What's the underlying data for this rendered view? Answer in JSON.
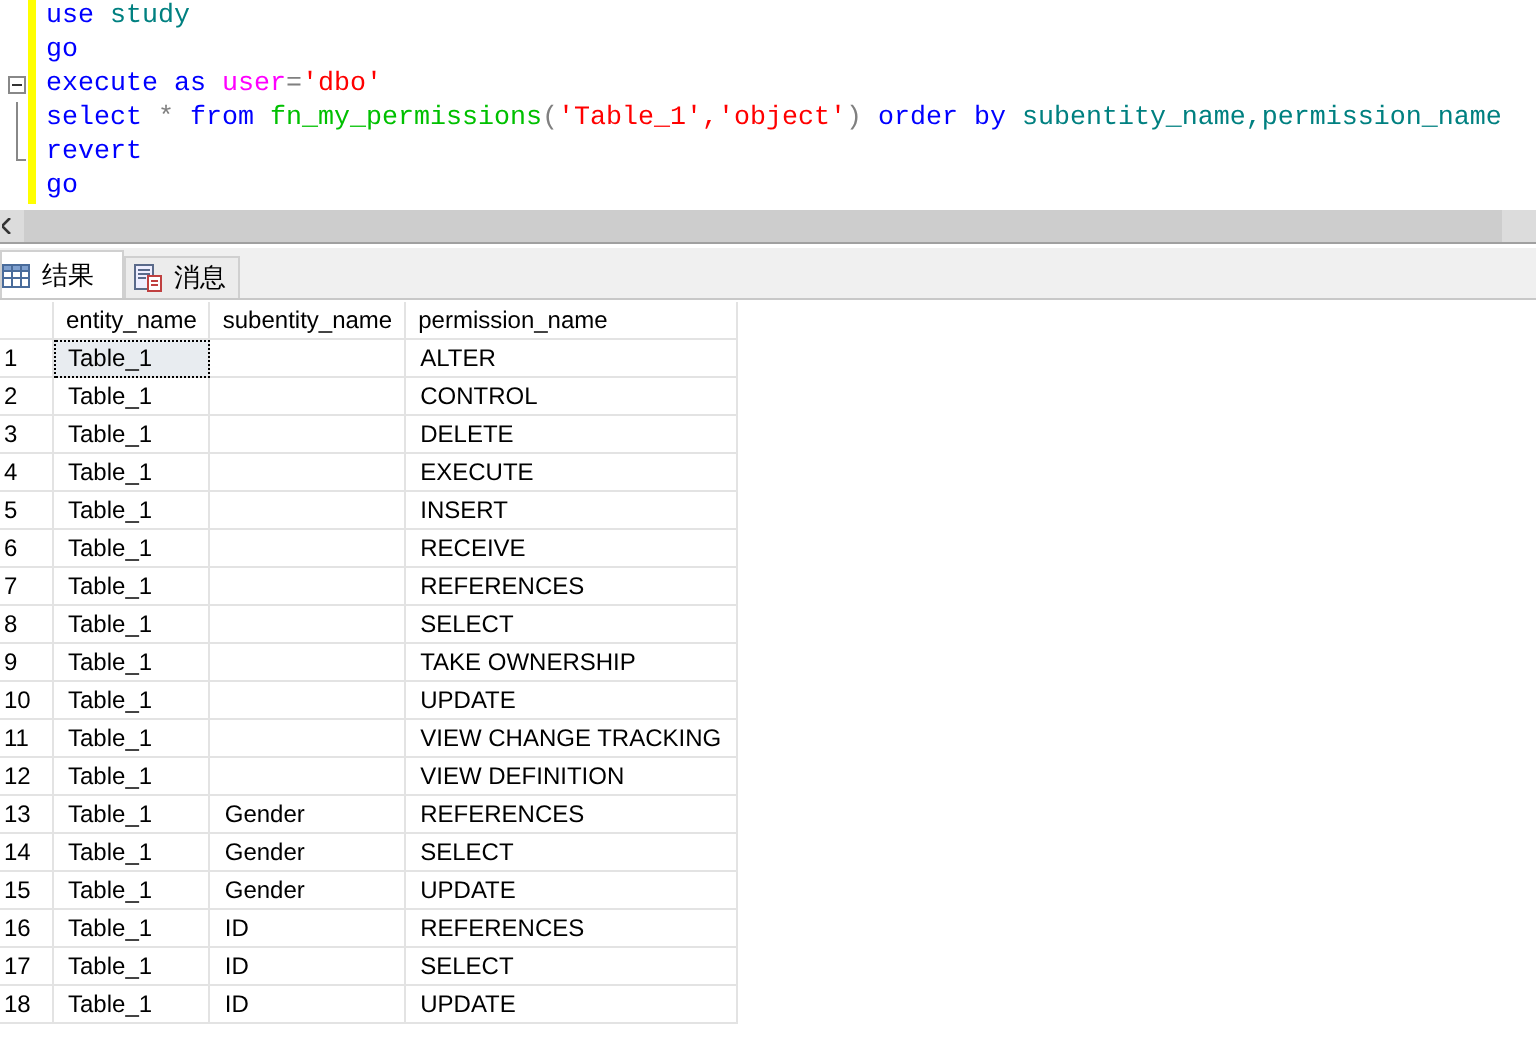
{
  "editor": {
    "lines": [
      {
        "kind": "plain",
        "tokens": [
          {
            "text": "use",
            "kind": "keyword"
          },
          {
            "text": "study",
            "kind": "ident",
            "space_before": true
          }
        ]
      },
      {
        "kind": "plain",
        "tokens": [
          {
            "text": "go",
            "kind": "keyword"
          }
        ]
      },
      {
        "kind": "fold_start",
        "tokens": [
          {
            "text": "execute",
            "kind": "keyword"
          },
          {
            "text": "as",
            "kind": "keyword",
            "space_before": true
          },
          {
            "text": "user",
            "kind": "system",
            "space_before": true
          },
          {
            "text": "=",
            "kind": "operator"
          },
          {
            "text": "'dbo'",
            "kind": "string"
          }
        ]
      },
      {
        "kind": "fold_middle",
        "tokens": [
          {
            "text": "select",
            "kind": "keyword"
          },
          {
            "text": "*",
            "kind": "operator",
            "space_before": true
          },
          {
            "text": "from",
            "kind": "keyword",
            "space_before": true
          },
          {
            "text": "fn_my_permissions",
            "kind": "function",
            "space_before": true
          },
          {
            "text": "(",
            "kind": "operator"
          },
          {
            "text": "'Table_1','object'",
            "kind": "string"
          },
          {
            "text": ")",
            "kind": "operator"
          },
          {
            "text": "order",
            "kind": "keyword",
            "space_before": true
          },
          {
            "text": "by",
            "kind": "keyword",
            "space_before": true
          },
          {
            "text": "subentity_name,permission_name",
            "kind": "ident",
            "space_before": true
          }
        ]
      },
      {
        "kind": "fold_end",
        "tokens": [
          {
            "text": "revert",
            "kind": "keyword"
          }
        ]
      },
      {
        "kind": "plain",
        "tokens": [
          {
            "text": "go",
            "kind": "keyword"
          }
        ]
      }
    ]
  },
  "tabs": [
    {
      "label": "结果",
      "kind": "grid",
      "selected": true
    },
    {
      "label": "消息",
      "kind": "message",
      "selected": false
    }
  ],
  "table": {
    "columns": [
      "entity_name",
      "subentity_name",
      "permission_name"
    ],
    "rows": [
      {
        "number": "1",
        "cells": [
          "Table_1",
          "",
          "ALTER"
        ],
        "selected": true
      },
      {
        "number": "2",
        "cells": [
          "Table_1",
          "",
          "CONTROL"
        ],
        "selected": false
      },
      {
        "number": "3",
        "cells": [
          "Table_1",
          "",
          "DELETE"
        ],
        "selected": false
      },
      {
        "number": "4",
        "cells": [
          "Table_1",
          "",
          "EXECUTE"
        ],
        "selected": false
      },
      {
        "number": "5",
        "cells": [
          "Table_1",
          "",
          "INSERT"
        ],
        "selected": false
      },
      {
        "number": "6",
        "cells": [
          "Table_1",
          "",
          "RECEIVE"
        ],
        "selected": false
      },
      {
        "number": "7",
        "cells": [
          "Table_1",
          "",
          "REFERENCES"
        ],
        "selected": false
      },
      {
        "number": "8",
        "cells": [
          "Table_1",
          "",
          "SELECT"
        ],
        "selected": false
      },
      {
        "number": "9",
        "cells": [
          "Table_1",
          "",
          "TAKE OWNERSHIP"
        ],
        "selected": false
      },
      {
        "number": "10",
        "cells": [
          "Table_1",
          "",
          "UPDATE"
        ],
        "selected": false
      },
      {
        "number": "11",
        "cells": [
          "Table_1",
          "",
          "VIEW CHANGE TRACKING"
        ],
        "selected": false
      },
      {
        "number": "12",
        "cells": [
          "Table_1",
          "",
          "VIEW DEFINITION"
        ],
        "selected": false
      },
      {
        "number": "13",
        "cells": [
          "Table_1",
          "Gender",
          "REFERENCES"
        ],
        "selected": false
      },
      {
        "number": "14",
        "cells": [
          "Table_1",
          "Gender",
          "SELECT"
        ],
        "selected": false
      },
      {
        "number": "15",
        "cells": [
          "Table_1",
          "Gender",
          "UPDATE"
        ],
        "selected": false
      },
      {
        "number": "16",
        "cells": [
          "Table_1",
          "ID",
          "REFERENCES"
        ],
        "selected": false
      },
      {
        "number": "17",
        "cells": [
          "Table_1",
          "ID",
          "SELECT"
        ],
        "selected": false
      },
      {
        "number": "18",
        "cells": [
          "Table_1",
          "ID",
          "UPDATE"
        ],
        "selected": false
      }
    ]
  }
}
